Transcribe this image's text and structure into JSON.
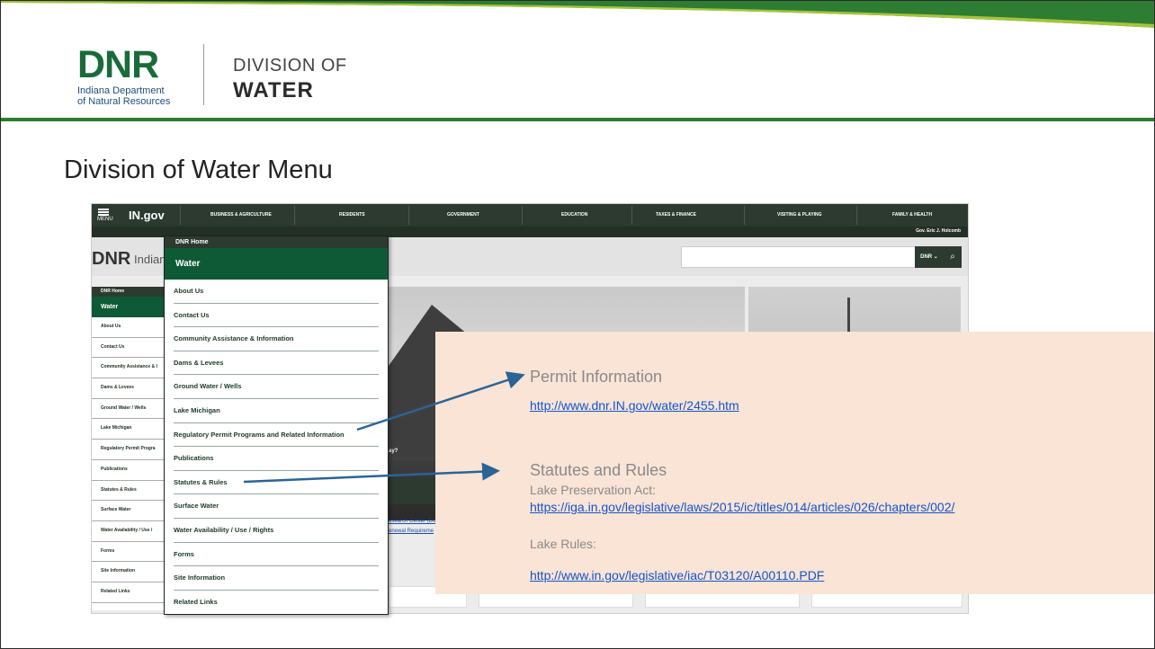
{
  "header": {
    "logo_text": "DNR",
    "logo_sub_line1": "Indiana Department",
    "logo_sub_line2": "of Natural Resources",
    "division_of": "DIVISION OF",
    "division_name": "WATER",
    "brand_green": "#2d7d32"
  },
  "slide": {
    "title": "Division of Water Menu"
  },
  "site": {
    "menu_label": "MENU",
    "ingov_logo": "IN.gov",
    "nav_items": [
      "BUSINESS & AGRICULTURE",
      "RESIDENTS",
      "GOVERNMENT",
      "EDUCATION",
      "TAXES & FINANCE",
      "VISITING & PLAYING",
      "FAMILY & HEALTH"
    ],
    "governor": "Gov. Eric J. Holcomb",
    "strip_logo": "DNR",
    "strip_text": "Indian",
    "search_scope": "DNR",
    "search_icon": "search-icon",
    "sidebar": {
      "home": "DNR Home",
      "section": "Water",
      "items": [
        "About Us",
        "Contact Us",
        "Community Assistance & I",
        "Dams & Levees",
        "Ground Water / Wells",
        "Lake Michigan",
        "Regulatory Permit Progra",
        "Publications",
        "Statutes & Rules",
        "Surface Water",
        "Water Availability / Use /",
        "Forms",
        "Site Information",
        "Related Links"
      ]
    },
    "photo_caption": "ay?",
    "body_link1": "esearch Center (Do",
    "body_link2": "enewal Requireme"
  },
  "dropdown": {
    "home": "DNR Home",
    "section": "Water",
    "items": [
      "About Us",
      "Contact Us",
      "Community Assistance & Information",
      "Dams & Levees",
      "Ground Water / Wells",
      "Lake Michigan",
      "Regulatory Permit Programs and Related Information",
      "Publications",
      "Statutes & Rules",
      "Surface Water",
      "Water Availability / Use / Rights",
      "Forms",
      "Site Information",
      "Related Links"
    ]
  },
  "callout": {
    "permit_heading": "Permit Information",
    "permit_link": "http://www.dnr.IN.gov/water/2455.htm",
    "statutes_heading": "Statutes and Rules",
    "lpa_label": "Lake Preservation Act:",
    "lpa_link": "https://iga.in.gov/legislative/laws/2015/ic/titles/014/articles/026/chapters/002/",
    "rules_label": "Lake Rules:",
    "rules_link": "http://www.in.gov/legislative/iac/T03120/A00110.PDF",
    "bg_color": "#fae4d6",
    "arrow_color": "#2a6496"
  }
}
